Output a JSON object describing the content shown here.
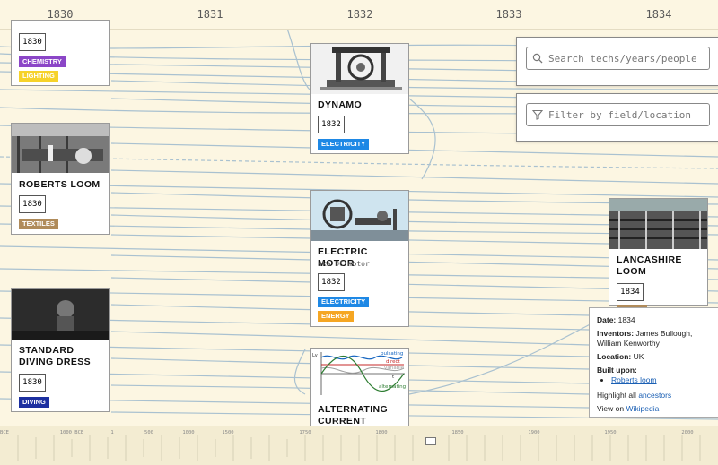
{
  "years": [
    "1830",
    "1831",
    "1832",
    "1833",
    "1834"
  ],
  "search": {
    "placeholder": "Search techs/years/people"
  },
  "filter": {
    "placeholder": "Filter by field/location"
  },
  "cards": {
    "top_left": {
      "year": "1830",
      "tags": [
        "chemistry",
        "lighting"
      ]
    },
    "dynamo": {
      "title": "DYNAMO",
      "year": "1832",
      "tags": [
        "electricity"
      ]
    },
    "roberts_loom": {
      "title": "ROBERTS LOOM",
      "year": "1830",
      "tags": [
        "textiles"
      ]
    },
    "electric_motor": {
      "title": "ELECTRIC MOTOR",
      "aka": "aka DC motor",
      "year": "1832",
      "tags": [
        "electricity",
        "energy"
      ]
    },
    "lancashire_loom": {
      "title": "LANCASHIRE LOOM",
      "year": "1834"
    },
    "standard_diving_dress": {
      "title": "STANDARD DIVING DRESS",
      "year": "1830",
      "tags": [
        "diving"
      ]
    },
    "alternating_current": {
      "title": "ALTERNATING CURRENT",
      "graph": {
        "axis_label": "Lv",
        "t_label": "t",
        "pulsating": "pulsating",
        "direct": "direct",
        "variable": "variable",
        "alternating": "alternating"
      }
    }
  },
  "detail": {
    "date_label": "Date:",
    "date": "1834",
    "inventors_label": "Inventors:",
    "inventors": "James Bullough, William Kenworthy",
    "location_label": "Location:",
    "location": "UK",
    "built_upon_label": "Built upon:",
    "built_upon": [
      "Roberts loom"
    ],
    "highlight_prefix": "Highlight all",
    "highlight_link": "ancestors",
    "view_prefix": "View on",
    "view_link": "Wikipedia"
  },
  "minimap": {
    "ticks": [
      "BCE",
      "1000 BCE",
      "1",
      "500",
      "1000",
      "1500",
      "1750",
      "1800",
      "1850",
      "1900",
      "1950",
      "2000"
    ]
  },
  "colors": {
    "background": "#fcf6e2",
    "link": "#a9c1d0",
    "chemistry": "#8b46c7",
    "lighting": "#f6d22a",
    "electricity": "#1e88e5",
    "energy": "#f5a623",
    "textiles": "#b08b5a",
    "diving": "#1c2fa0"
  }
}
